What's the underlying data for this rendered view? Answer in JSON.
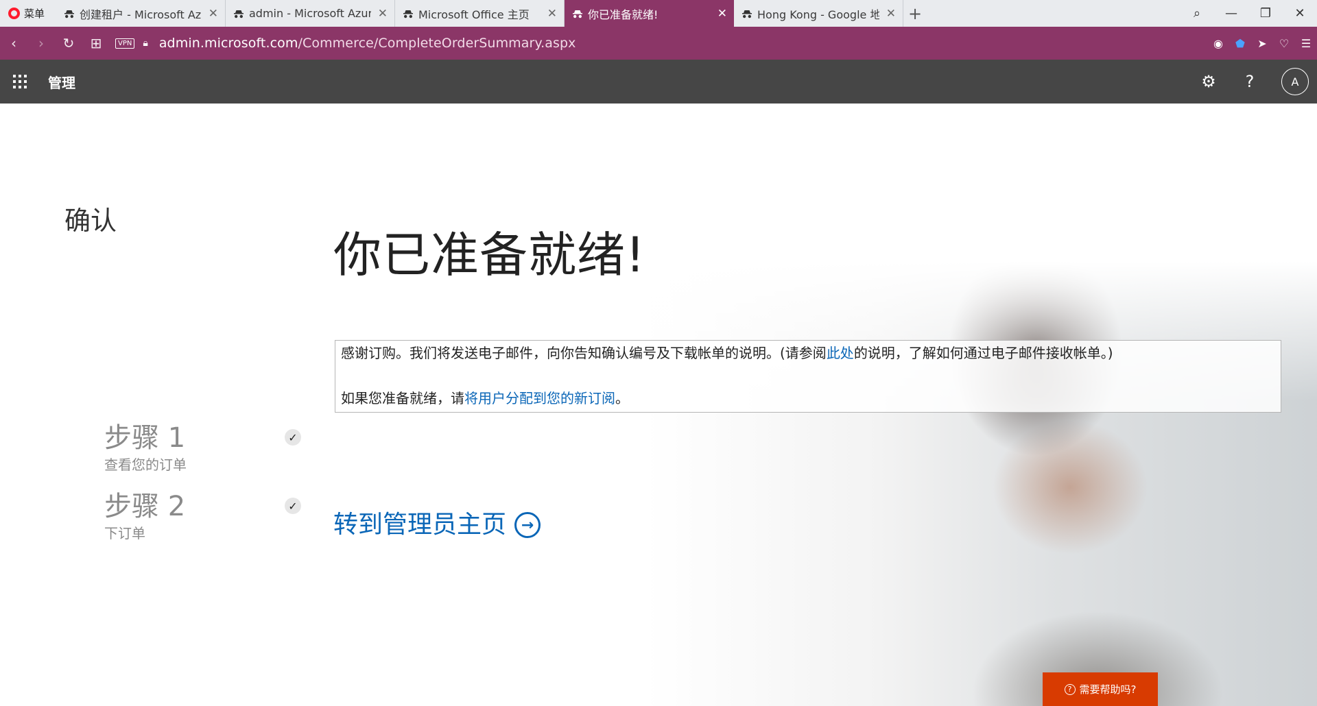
{
  "browser": {
    "menu_label": "菜单",
    "tabs": [
      {
        "label": "创建租户 - Microsoft Azure",
        "active": false
      },
      {
        "label": "admin - Microsoft Azure",
        "active": false
      },
      {
        "label": "Microsoft Office 主页",
        "active": false
      },
      {
        "label": "你已准备就绪!",
        "active": true
      },
      {
        "label": "Hong Kong - Google 地图",
        "active": false
      }
    ],
    "new_tab": "+",
    "vpn_label": "VPN",
    "url_host": "admin.microsoft.com",
    "url_path": "/Commerce/CompleteOrderSummary.aspx",
    "accent_color": "#8b3667"
  },
  "header": {
    "app_title": "管理",
    "avatar_initial": "A"
  },
  "sidebar": {
    "title": "确认",
    "steps": [
      {
        "title": "步骤 1",
        "subtitle": "查看您的订单",
        "done": true
      },
      {
        "title": "步骤 2",
        "subtitle": "下订单",
        "done": true
      }
    ]
  },
  "main": {
    "headline": "你已准备就绪!",
    "message": {
      "line1_before": "感谢订购。我们将发送电子邮件，向你告知确认编号及下载帐单的说明。(请参阅",
      "line1_link": "此处",
      "line1_after": "的说明，了解如何通过电子邮件接收帐单。)",
      "line2_before": "如果您准备就绪，请",
      "line2_link": "将用户分配到您的新订阅",
      "line2_after": "。"
    },
    "admin_link": "转到管理员主页",
    "help_button": "需要帮助吗?"
  }
}
